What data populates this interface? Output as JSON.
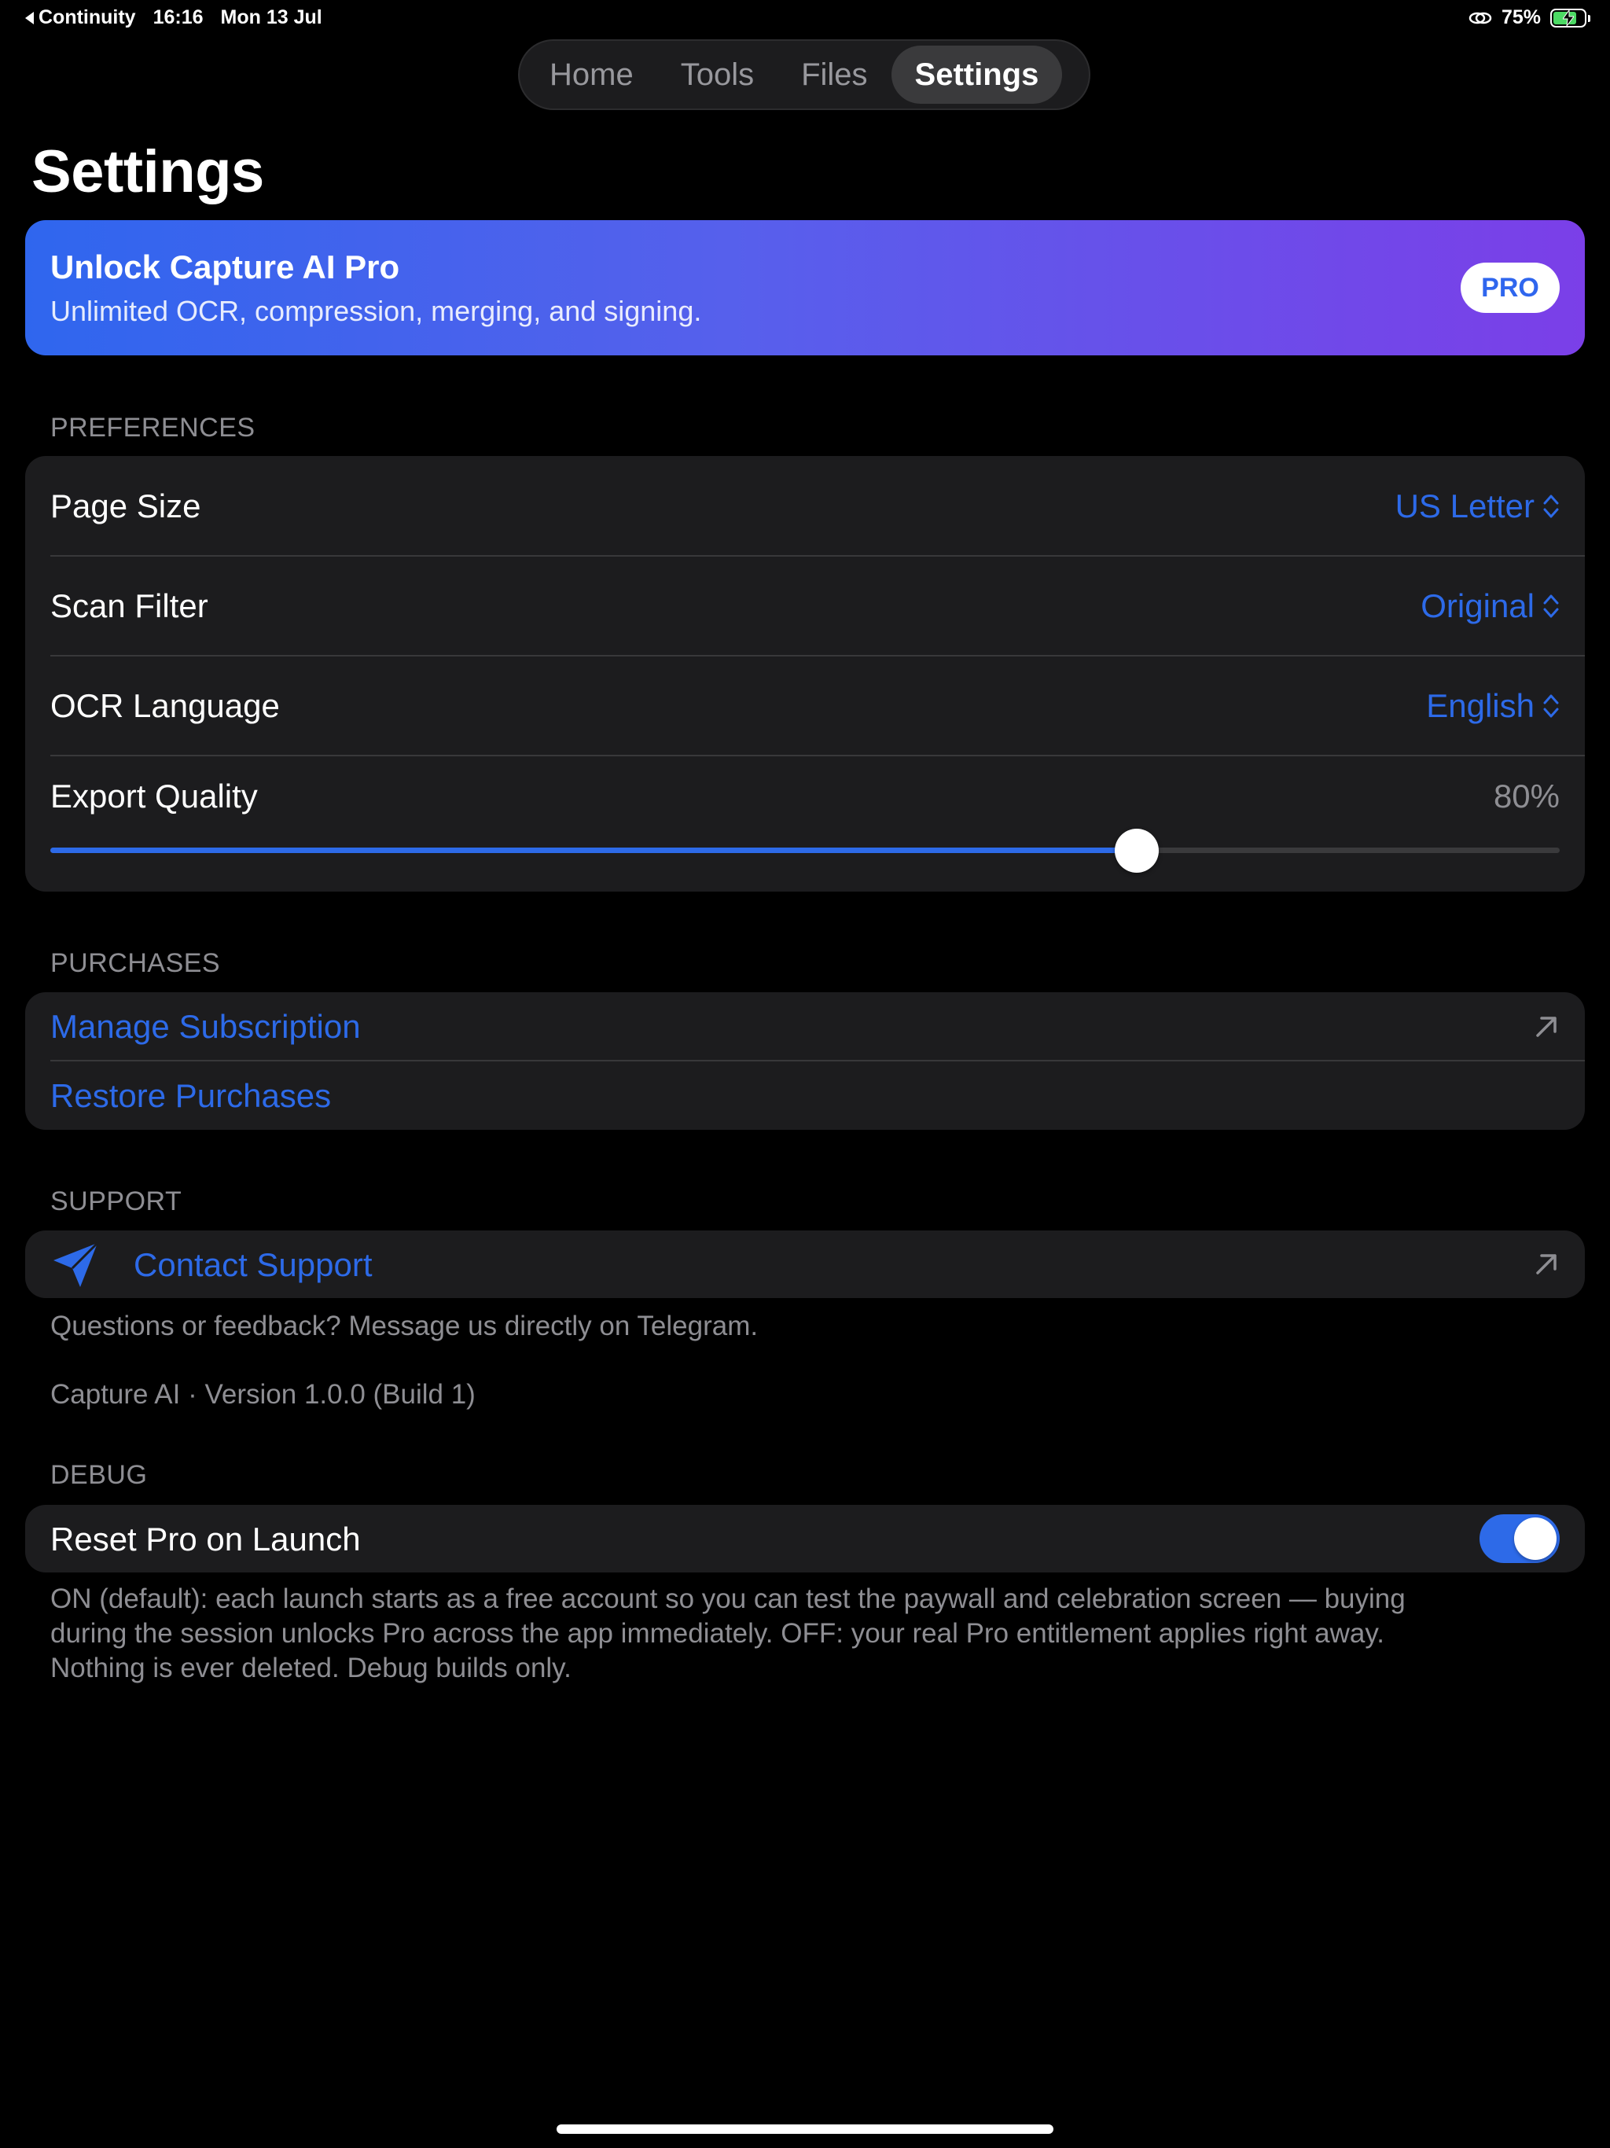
{
  "status_bar": {
    "back_app": "Continuity",
    "time": "16:16",
    "date": "Mon 13 Jul",
    "battery_percent": "75%",
    "battery_level": 0.75,
    "battery_color": "#4cd964"
  },
  "tabs": [
    {
      "label": "Home",
      "active": false
    },
    {
      "label": "Tools",
      "active": false
    },
    {
      "label": "Files",
      "active": false
    },
    {
      "label": "Settings",
      "active": true
    }
  ],
  "page_title": "Settings",
  "pro_banner": {
    "title": "Unlock Capture AI Pro",
    "subtitle": "Unlimited OCR, compression, merging, and signing.",
    "badge": "PRO",
    "gradient": [
      "#2f66ee",
      "#7b3fe8"
    ]
  },
  "preferences": {
    "header": "PREFERENCES",
    "page_size": {
      "label": "Page Size",
      "value": "US Letter"
    },
    "scan_filter": {
      "label": "Scan Filter",
      "value": "Original"
    },
    "ocr_language": {
      "label": "OCR Language",
      "value": "English"
    },
    "export_quality": {
      "label": "Export Quality",
      "value_text": "80%",
      "level": 0.72
    }
  },
  "purchases": {
    "header": "PURCHASES",
    "manage_subscription": "Manage Subscription",
    "restore_purchases": "Restore Purchases"
  },
  "support": {
    "header": "SUPPORT",
    "contact_support": "Contact Support",
    "footnote": "Questions or feedback? Message us directly on Telegram.",
    "version": "Capture AI · Version 1.0.0 (Build 1)"
  },
  "debug": {
    "header": "DEBUG",
    "reset_pro_label": "Reset Pro on Launch",
    "reset_pro_on": true,
    "footnote_line1": "ON (default): each launch starts as a free account so you can test the paywall and celebration screen — buying",
    "footnote_line2": "during the session unlocks Pro across the app immediately. OFF: your real Pro entitlement applies right away.",
    "footnote_line3": "Nothing is ever deleted. Debug builds only."
  },
  "colors": {
    "accent": "#2d6ae8",
    "background": "#000000",
    "group_bg": "#1c1c1e",
    "secondary_text": "#8e8e93"
  },
  "icons": {
    "back": "back-triangle-icon",
    "personal_hotspot": "link-icon",
    "battery": "battery-charging-icon",
    "chevron": "chevron-up-down-icon",
    "external": "arrow-up-right-icon",
    "send": "paper-plane-icon"
  }
}
